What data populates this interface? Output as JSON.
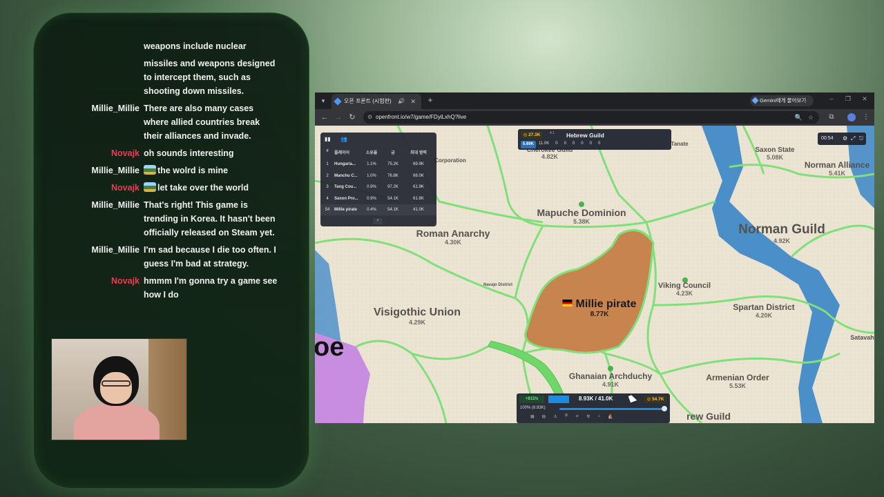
{
  "chat": {
    "messages": [
      {
        "user": "",
        "text": "weapons include nuclear",
        "red": false,
        "emote": false
      },
      {
        "user": "",
        "text": "missiles and weapons designed to intercept them, such as shooting down missiles.",
        "red": false,
        "emote": false
      },
      {
        "user": "Millie_Millie",
        "text": "There are also many cases where allied countries break their alliances and invade.",
        "red": false,
        "emote": false
      },
      {
        "user": "Novajk",
        "text": "oh sounds interesting",
        "red": true,
        "emote": false
      },
      {
        "user": "Millie_Millie",
        "text": "the wolrd is mine",
        "red": false,
        "emote": true
      },
      {
        "user": "Novajk",
        "text": "let take over the world",
        "red": true,
        "emote": true
      },
      {
        "user": "Millie_Millie",
        "text": "That's right! This game is trending in Korea. It hasn't been officially released on Steam yet.",
        "red": false,
        "emote": false
      },
      {
        "user": "Millie_Millie",
        "text": "I'm sad because I die too often. I guess I'm bad at strategy.",
        "red": false,
        "emote": false
      },
      {
        "user": "Novajk",
        "text": "hmmm I'm gonna try a game see how I do",
        "red": true,
        "emote": false
      }
    ]
  },
  "browser": {
    "tab_title": "오픈 프론트 (시험판)",
    "url": "openfront.io/w7/game/FDyiLxhQ?live",
    "gemini_label": "Gemini에게 물어보기"
  },
  "leaderboard": {
    "headers": [
      "#",
      "플레이어",
      "소유율",
      "금",
      "최대 병력"
    ],
    "rows": [
      {
        "rank": "1",
        "name": "Hungaria...",
        "own": "1.1%",
        "gold": "75.2K",
        "max": "69.9K"
      },
      {
        "rank": "2",
        "name": "Manchu C...",
        "own": "1.0%",
        "gold": "76.8K",
        "max": "66.0K"
      },
      {
        "rank": "3",
        "name": "Tang Cou...",
        "own": "0.9%",
        "gold": "97.2K",
        "max": "61.9K"
      },
      {
        "rank": "4",
        "name": "Saxon Pro...",
        "own": "0.9%",
        "gold": "54.1K",
        "max": "61.8K"
      },
      {
        "rank": "54",
        "name": "Millie pirate",
        "own": "0.4%",
        "gold": "54.1K",
        "max": "41.0K"
      }
    ]
  },
  "hover_panel": {
    "gold": "27.3K",
    "troops": "5.69K",
    "name": "Hebrew Guild",
    "small": "4.1",
    "units": [
      "11.0K",
      "0",
      "0",
      "0",
      "0",
      "0",
      "0"
    ]
  },
  "timer": "00:54",
  "territories": [
    {
      "name": "Corporation",
      "pop": "",
      "size": 8
    },
    {
      "name": "Cherokee Guild",
      "pop": "4.82K",
      "size": 9
    },
    {
      "name": "Tanate",
      "pop": "",
      "size": 8
    },
    {
      "name": "Saxon State",
      "pop": "5.08K",
      "size": 10
    },
    {
      "name": "Norman Alliance",
      "pop": "5.41K",
      "size": 12
    },
    {
      "name": "Mapuche Dominion",
      "pop": "5.38K",
      "size": 14
    },
    {
      "name": "Roman Anarchy",
      "pop": "4.30K",
      "size": 14
    },
    {
      "name": "Norman Guild",
      "pop": "4.92K",
      "size": 19
    },
    {
      "name": "Navajo District",
      "pop": "",
      "size": 6
    },
    {
      "name": "Viking Council",
      "pop": "4.23K",
      "size": 11
    },
    {
      "name": "Spartan District",
      "pop": "4.20K",
      "size": 12
    },
    {
      "name": "Visigothic Union",
      "pop": "4.29K",
      "size": 16
    },
    {
      "name": "Satavaha",
      "pop": "",
      "size": 9
    },
    {
      "name": "Ghanaian Archduchy",
      "pop": "4.91K",
      "size": 12
    },
    {
      "name": "Armenian Order",
      "pop": "5.53K",
      "size": 12
    },
    {
      "name": "rew Guild",
      "pop": "",
      "size": 14
    }
  ],
  "player": {
    "name": "Millie pirate",
    "pop": "8.77K",
    "flag": "german-flag"
  },
  "edge_text": "oe",
  "bottom_bar": {
    "pop_rate": "+812/s",
    "troops": "8.93K / 41.0K",
    "gold": "54.7K",
    "attack_ratio": "100% (8.93K)",
    "troop_fill": 0.22,
    "attack_fill": 1.0
  },
  "colors": {
    "player_fill": "#c8844f",
    "border_green": "#7fe07a",
    "water": "#2f80c8",
    "enemy_purple": "#c78ee0"
  }
}
